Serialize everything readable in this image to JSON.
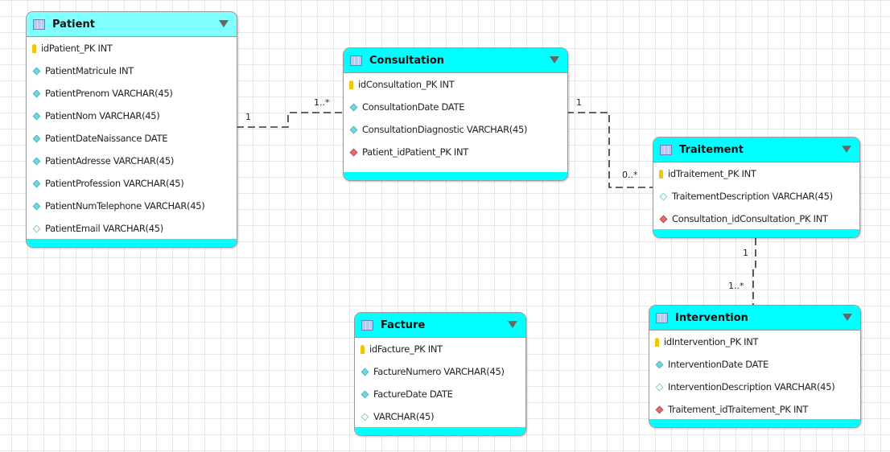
{
  "tables": {
    "patient": {
      "title": "Patient",
      "columns": [
        {
          "text": "idPatient_PK INT",
          "kind": "pk"
        },
        {
          "text": "PatientMatricule INT",
          "kind": "nn"
        },
        {
          "text": "PatientPrenom VARCHAR(45)",
          "kind": "nn"
        },
        {
          "text": "PatientNom VARCHAR(45)",
          "kind": "nn"
        },
        {
          "text": "PatientDateNaissance DATE",
          "kind": "nn"
        },
        {
          "text": "PatientAdresse VARCHAR(45)",
          "kind": "nn"
        },
        {
          "text": "PatientProfession VARCHAR(45)",
          "kind": "nn"
        },
        {
          "text": "PatientNumTelephone VARCHAR(45)",
          "kind": "nn"
        },
        {
          "text": "PatientEmail VARCHAR(45)",
          "kind": "nl"
        }
      ]
    },
    "consultation": {
      "title": "Consultation",
      "columns": [
        {
          "text": "idConsultation_PK INT",
          "kind": "pk"
        },
        {
          "text": "ConsultationDate DATE",
          "kind": "nn"
        },
        {
          "text": "ConsultationDiagnostic VARCHAR(45)",
          "kind": "nn"
        },
        {
          "text": "Patient_idPatient_PK INT",
          "kind": "fk"
        }
      ]
    },
    "traitement": {
      "title": "Traitement",
      "columns": [
        {
          "text": "idTraitement_PK INT",
          "kind": "pk"
        },
        {
          "text": "TraitementDescription VARCHAR(45)",
          "kind": "nl"
        },
        {
          "text": "Consultation_idConsultation_PK INT",
          "kind": "fk"
        }
      ]
    },
    "intervention": {
      "title": "Intervention",
      "columns": [
        {
          "text": "idIntervention_PK INT",
          "kind": "pk"
        },
        {
          "text": "InterventionDate DATE",
          "kind": "nn"
        },
        {
          "text": "InterventionDescription VARCHAR(45)",
          "kind": "nl"
        },
        {
          "text": "Traitement_idTraitement_PK INT",
          "kind": "fk"
        }
      ]
    },
    "facture": {
      "title": "Facture",
      "columns": [
        {
          "text": "idFacture_PK INT",
          "kind": "pk"
        },
        {
          "text": "FactureNumero VARCHAR(45)",
          "kind": "nn"
        },
        {
          "text": "FactureDate DATE",
          "kind": "nn"
        },
        {
          "text": " VARCHAR(45)",
          "kind": "nl"
        }
      ]
    }
  },
  "relations": {
    "patient_consultation": {
      "from": "1",
      "to": "1..*"
    },
    "consultation_traitement": {
      "from": "1",
      "to": "0..*"
    },
    "traitement_intervention": {
      "from": "1",
      "to": "1..*"
    }
  },
  "colors": {
    "header": "#00ffff",
    "selected_header": "#80ffff",
    "pk": "#f0c800",
    "fk": "#e07070"
  }
}
